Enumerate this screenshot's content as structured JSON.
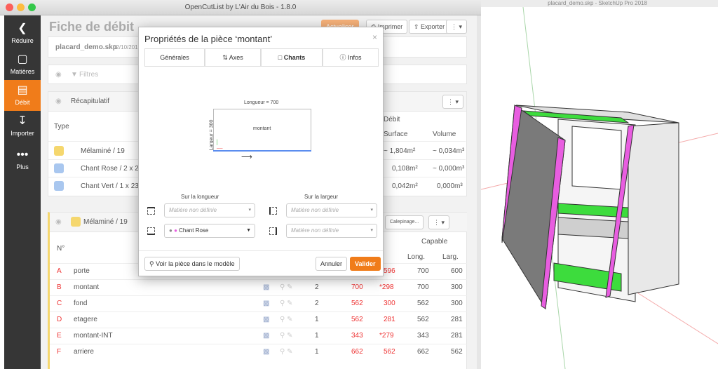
{
  "window": {
    "title": "OpenCutList by L'Air du Bois - 1.8.0",
    "sketchup_title": "placard_demo.skp - SketchUp Pro 2018"
  },
  "sidebar": {
    "items": [
      {
        "label": "Réduire",
        "icon": "chevron-left-icon"
      },
      {
        "label": "Matières",
        "icon": "materials-icon"
      },
      {
        "label": "Débit",
        "icon": "cutlist-icon"
      },
      {
        "label": "Importer",
        "icon": "import-icon"
      },
      {
        "label": "Plus",
        "icon": "more-icon"
      }
    ]
  },
  "page": {
    "title": "Fiche de débit",
    "filename": "placard_demo.skp",
    "date": "02/10/2019",
    "toolbar": {
      "refresh": "Actualiser",
      "print": "Imprimer",
      "export": "Exporter"
    }
  },
  "filters": {
    "label": "Filtres"
  },
  "recap": {
    "title": "Récapitulatif",
    "col_type": "Type",
    "col_debit": "Débit",
    "col_surface": "Surface",
    "col_volume": "Volume",
    "rows": [
      {
        "name": "Mélaminé / 19",
        "surface": "~ 1,804m²",
        "volume": "~ 0,034m³"
      },
      {
        "name": "Chant Rose / 2 x 23",
        "surface": "0,108m²",
        "volume": "~ 0,000m³"
      },
      {
        "name": "Chant Vert / 1 x 23",
        "surface": "0,042m²",
        "volume": "0,000m³"
      }
    ]
  },
  "list": {
    "group": "Mélaminé / 19",
    "calepinage": "Calepinage...",
    "col_num": "N°",
    "col_capable": "Capable",
    "col_long": "Long.",
    "col_larg": "Larg.",
    "rows": [
      {
        "id": "A",
        "name": "porte",
        "qty": "",
        "l1": "",
        "l2": "596",
        "cl": "700",
        "cw": "600"
      },
      {
        "id": "B",
        "name": "montant",
        "qty": "2",
        "l1": "700",
        "l2": "*298",
        "cl": "700",
        "cw": "300"
      },
      {
        "id": "C",
        "name": "fond",
        "qty": "2",
        "l1": "562",
        "l2": "300",
        "cl": "562",
        "cw": "300"
      },
      {
        "id": "D",
        "name": "etagere",
        "qty": "1",
        "l1": "562",
        "l2": "281",
        "cl": "562",
        "cw": "281"
      },
      {
        "id": "E",
        "name": "montant-INT",
        "qty": "1",
        "l1": "343",
        "l2": "*279",
        "cl": "343",
        "cw": "281"
      },
      {
        "id": "F",
        "name": "arriere",
        "qty": "1",
        "l1": "662",
        "l2": "562",
        "cl": "662",
        "cw": "562"
      }
    ]
  },
  "modal": {
    "title": "Propriétés de la pièce ‘montant’",
    "tabs": [
      "Générales",
      "Axes",
      "Chants",
      "Infos"
    ],
    "length_label": "Longueur = 700",
    "width_label": "Largeur = 300",
    "piece_label": "montant",
    "sur_longueur": "Sur la longueur",
    "sur_largeur": "Sur la largeur",
    "placeholder": "Matière non définie",
    "chant_rose": "Chant Rose",
    "show_button": "Voir la pièce dans le modèle",
    "cancel": "Annuler",
    "validate": "Valider"
  },
  "colors": {
    "accent": "#f07c1a",
    "sidebar": "#363636",
    "pink": "#e85de0",
    "green": "#3ddc3d"
  }
}
